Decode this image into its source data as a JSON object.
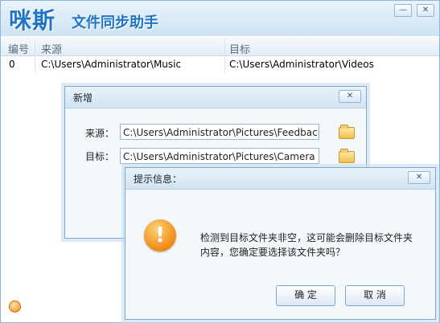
{
  "app": {
    "logo": "咪斯",
    "title": "文件同步助手",
    "minimize": "—",
    "close": "✕"
  },
  "table": {
    "headers": [
      "编号",
      "来源",
      "目标"
    ],
    "rows": [
      {
        "id": "0",
        "source": "C:\\Users\\Administrator\\Music",
        "target": "C:\\Users\\Administrator\\Videos"
      }
    ]
  },
  "add_dialog": {
    "title": "新增",
    "close": "✕",
    "source_label": "来源：",
    "source_value": "C:\\Users\\Administrator\\Pictures\\Feedback",
    "target_label": "目标：",
    "target_value": "C:\\Users\\Administrator\\Pictures\\Camera Ro"
  },
  "msg_dialog": {
    "title": "提示信息：",
    "close": "✕",
    "icon": "!",
    "text": "检测到目标文件夹非空，这可能会删除目标文件夹内容，您确定要选择该文件夹吗？",
    "ok": "确 定",
    "cancel": "取 消"
  }
}
